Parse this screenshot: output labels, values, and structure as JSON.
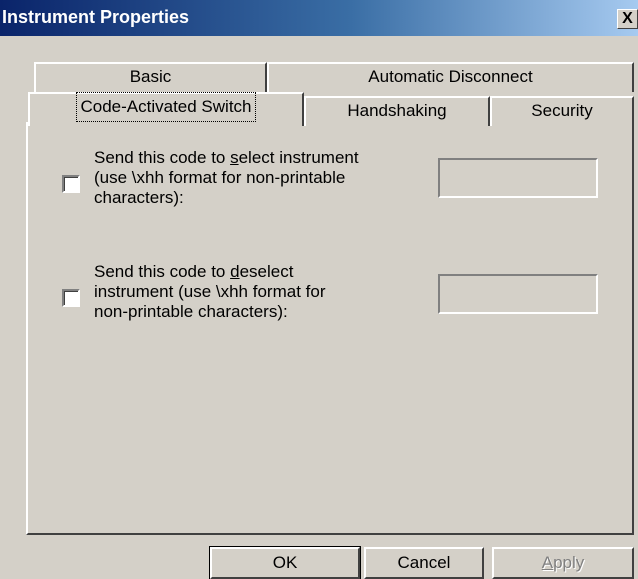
{
  "window": {
    "title": "Instrument Properties",
    "close_glyph": "X"
  },
  "tabs": {
    "row1": [
      {
        "label": "Basic"
      },
      {
        "label": "Automatic Disconnect"
      }
    ],
    "row2": [
      {
        "label": "Code-Activated Switch",
        "selected": true
      },
      {
        "label": "Handshaking"
      },
      {
        "label": "Security"
      }
    ]
  },
  "options": {
    "select": {
      "label_pre": "Send this code to ",
      "label_accel": "s",
      "label_post": "elect instrument",
      "line2": "(use \\xhh format for non-printable",
      "line3": "characters):",
      "checked": false,
      "value": ""
    },
    "deselect": {
      "label_pre": "Send this code to ",
      "label_accel": "d",
      "label_post": "eselect",
      "line2": "instrument (use \\xhh format for",
      "line3": "non-printable characters):",
      "checked": false,
      "value": ""
    }
  },
  "buttons": {
    "ok": "OK",
    "cancel": "Cancel",
    "apply_accel": "A",
    "apply_rest": "pply"
  }
}
